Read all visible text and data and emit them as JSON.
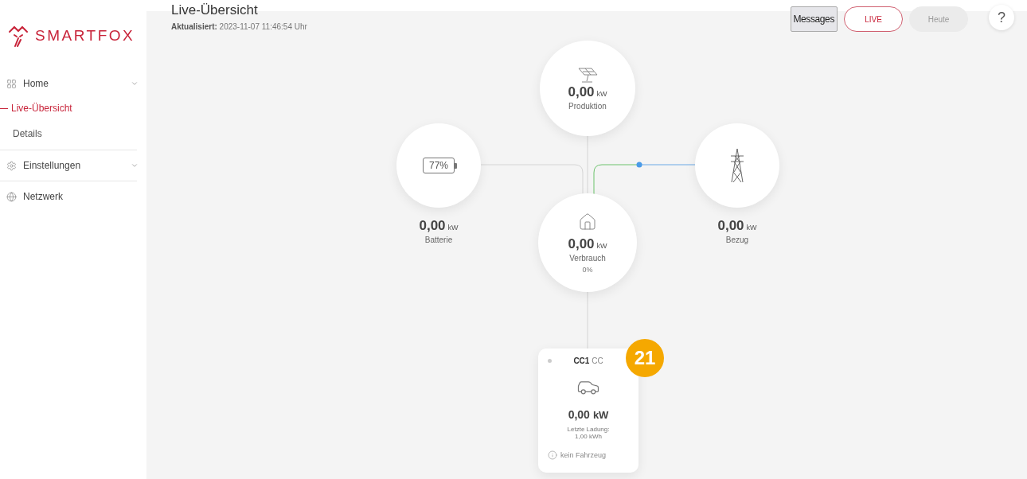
{
  "brand": {
    "name": "SMARTFOX"
  },
  "sidebar": {
    "items": [
      {
        "label": "Home",
        "kind": "group",
        "children": [
          {
            "label": "Live-Übersicht",
            "selected": true
          },
          {
            "label": "Details",
            "selected": false
          }
        ]
      },
      {
        "label": "Einstellungen",
        "kind": "group"
      },
      {
        "label": "Netzwerk",
        "kind": "link"
      }
    ]
  },
  "header": {
    "title": "Live-Übersicht",
    "updated": "**Aktualisiert:** 2023-11-07 11:46:54 Uhr",
    "messages_button": "Messages",
    "mode_tabs": [
      {
        "label": "LIVE",
        "selected": true
      },
      {
        "label": "Heute",
        "selected": false
      }
    ],
    "help_button": "?"
  },
  "flow": {
    "nodes": [
      {
        "kind": "production",
        "value": "0,00",
        "unit": "kW",
        "label": "Produktion"
      },
      {
        "kind": "battery",
        "battery_text": "77%",
        "value": "0,00",
        "unit": "kW",
        "label": "Batterie"
      },
      {
        "kind": "grid",
        "value": "0,00",
        "unit": "kW",
        "label": "Bezug"
      },
      {
        "kind": "consumption",
        "value": "0,00",
        "unit": "kW",
        "label": "Verbrauch",
        "share": "0%"
      }
    ],
    "charger": {
      "name": "CC1",
      "type": "CC",
      "value": "0,00",
      "unit": "kW",
      "last_charge_label": "Letzte Ladung:",
      "last_charge_value": "1,00 kWh",
      "status": "kein Fahrzeug"
    },
    "badge": "21"
  }
}
